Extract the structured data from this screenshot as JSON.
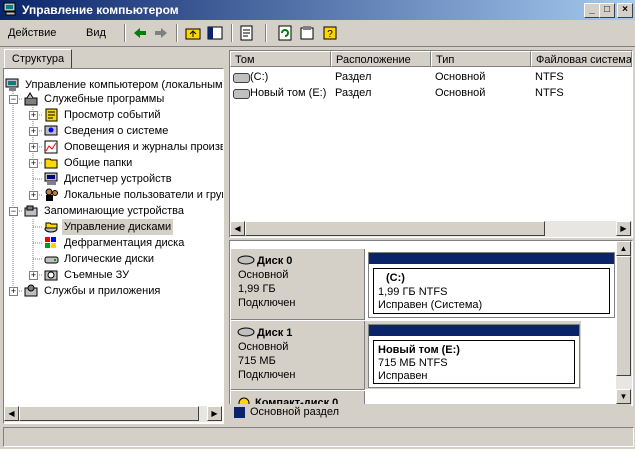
{
  "window": {
    "title": "Управление компьютером",
    "min": "_",
    "max": "□",
    "close": "×"
  },
  "menu": {
    "action": "Действие",
    "view": "Вид"
  },
  "left_pane": {
    "tab": "Структура",
    "tree": [
      {
        "label": "Управление компьютером (локальным)",
        "level": 0
      },
      {
        "label": "Служебные программы",
        "level": 1
      },
      {
        "label": "Просмотр событий",
        "level": 2
      },
      {
        "label": "Сведения о системе",
        "level": 2
      },
      {
        "label": "Оповещения и журналы производительности",
        "level": 2
      },
      {
        "label": "Общие папки",
        "level": 2
      },
      {
        "label": "Диспетчер устройств",
        "level": 2
      },
      {
        "label": "Локальные пользователи и группы",
        "level": 2
      },
      {
        "label": "Запоминающие устройства",
        "level": 1
      },
      {
        "label": "Управление дисками",
        "level": 2
      },
      {
        "label": "Дефрагментация диска",
        "level": 2
      },
      {
        "label": "Логические диски",
        "level": 2
      },
      {
        "label": "Съемные ЗУ",
        "level": 2
      },
      {
        "label": "Службы и приложения",
        "level": 1
      }
    ]
  },
  "volume_list": {
    "columns": [
      "Том",
      "Расположение",
      "Тип",
      "Файловая система"
    ],
    "rows": [
      [
        "(C:)",
        "Раздел",
        "Основной",
        "NTFS"
      ],
      [
        "Новый том (E:)",
        "Раздел",
        "Основной",
        "NTFS"
      ]
    ]
  },
  "disks": [
    {
      "name": "Диск 0",
      "type": "Основной",
      "size": "1,99 ГБ",
      "state": "Подключен",
      "volume": {
        "title": "(C:)",
        "info": "1,99 ГБ NTFS",
        "status": "Исправен (Система)"
      }
    },
    {
      "name": "Диск 1",
      "type": "Основной",
      "size": "715 МБ",
      "state": "Подключен",
      "volume": {
        "title": "Новый том  (E:)",
        "info": "715 МБ NTFS",
        "status": "Исправен"
      }
    },
    {
      "name": "Компакт-диск 0"
    }
  ],
  "legend": {
    "color": "#0a246a",
    "label": "Основной раздел"
  },
  "colors": {
    "titlebar_start": "#0a246a",
    "titlebar_end": "#a6caf0",
    "face": "#d4d0c8"
  }
}
